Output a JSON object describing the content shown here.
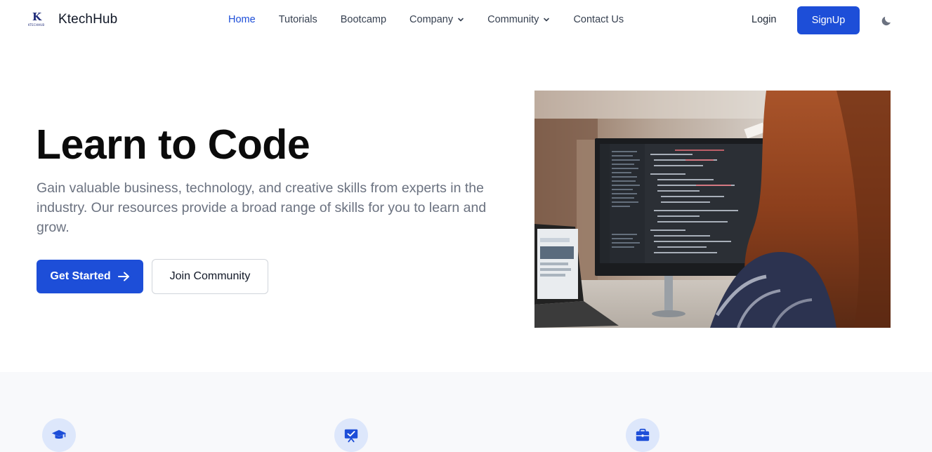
{
  "brand": {
    "name": "KtechHub",
    "logo_letter": "K",
    "logo_subtext": "KTECHHUB"
  },
  "nav": {
    "items": [
      {
        "label": "Home",
        "active": true,
        "dropdown": false
      },
      {
        "label": "Tutorials",
        "active": false,
        "dropdown": false
      },
      {
        "label": "Bootcamp",
        "active": false,
        "dropdown": false
      },
      {
        "label": "Company",
        "active": false,
        "dropdown": true
      },
      {
        "label": "Community",
        "active": false,
        "dropdown": true
      },
      {
        "label": "Contact Us",
        "active": false,
        "dropdown": false
      }
    ],
    "login_label": "Login",
    "signup_label": "SignUp",
    "theme_icon": "moon-icon"
  },
  "hero": {
    "title": "Learn to Code",
    "description": "Gain valuable business, technology, and creative skills from experts in the industry. Our resources provide a broad range of skills for you to learn and grow.",
    "primary_label": "Get Started",
    "primary_icon": "arrow-right-icon",
    "secondary_label": "Join Community",
    "image": "woman-coding-at-monitor-photo"
  },
  "features": {
    "icons": [
      "graduation-cap-icon",
      "presentation-check-icon",
      "briefcase-icon"
    ]
  },
  "colors": {
    "primary": "#1d4ed8",
    "text_dark": "#111827",
    "text_muted": "#6b7280",
    "section_bg": "#f8f9fb",
    "icon_circle": "#dde7fb"
  }
}
